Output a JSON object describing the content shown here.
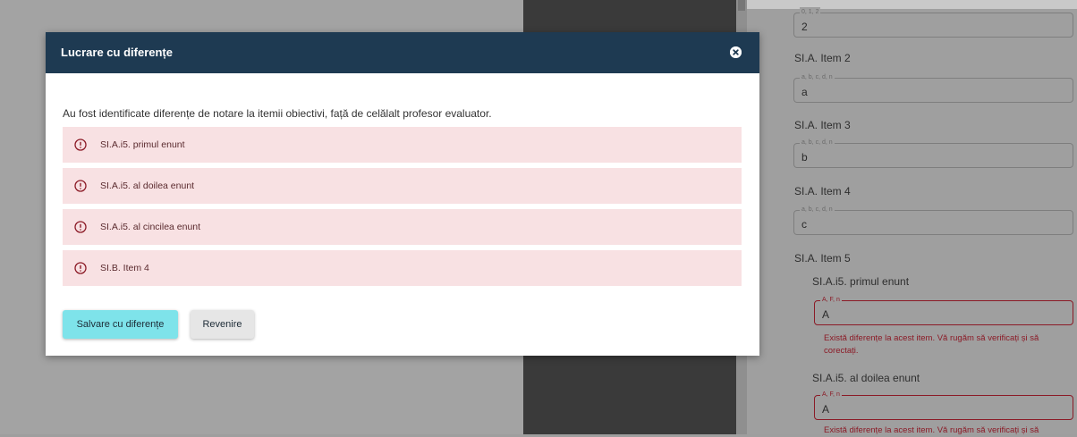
{
  "background_form": {
    "field0": {
      "legend": "0, 1, 2",
      "value": "2"
    },
    "items": [
      {
        "label": "SI.A. Item 2",
        "legend": "a, b, c, d, n",
        "value": "a"
      },
      {
        "label": "SI.A. Item 3",
        "legend": "a, b, c, d, n",
        "value": "b"
      },
      {
        "label": "SI.A. Item 4",
        "legend": "a, b, c, d, n",
        "value": "c"
      }
    ],
    "item5_label": "SI.A. Item 5",
    "subitems": [
      {
        "label": "SI.A.i5. primul enunt",
        "legend": "A, F, n",
        "value": "A",
        "error": "Există diferențe la acest item. Vă rugăm să verificați și să corectați."
      },
      {
        "label": "SI.A.i5. al doilea enunt",
        "legend": "A, F, n",
        "value": "A",
        "error": "Există diferențe la acest item. Vă rugăm să verificați și să"
      }
    ]
  },
  "modal": {
    "title": "Lucrare cu diferențe",
    "message": "Au fost identificate diferențe de notare la itemii obiectivi, față de celălalt profesor evaluator.",
    "differences": [
      "SI.A.i5. primul enunt",
      "SI.A.i5. al doilea enunt",
      "SI.A.i5. al cincilea enunt",
      "SI.B. Item 4"
    ],
    "save_label": "Salvare cu diferențe",
    "back_label": "Revenire"
  },
  "colors": {
    "header": "#1e3a52",
    "save_button": "#7ee3ea",
    "error_bg": "#f8e1e3",
    "error_text": "#8b1a26"
  },
  "icons": {
    "close": "close-circle-icon",
    "warning": "alert-circle-icon"
  }
}
